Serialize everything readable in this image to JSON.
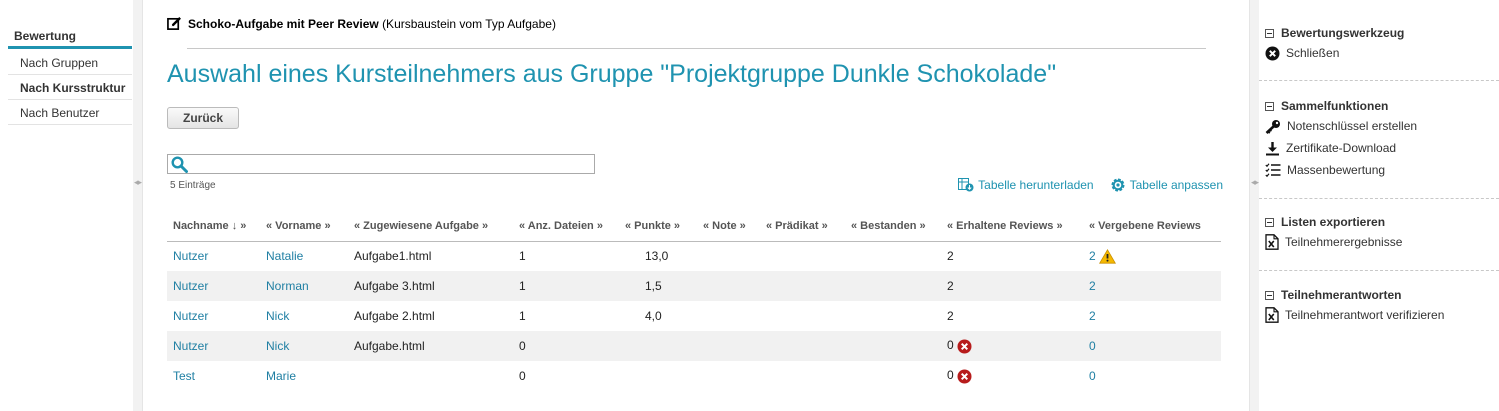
{
  "left_nav": {
    "header": "Bewertung",
    "items": [
      {
        "label": "Nach Gruppen",
        "active": false
      },
      {
        "label": "Nach Kursstruktur",
        "active": true
      },
      {
        "label": "Nach Benutzer",
        "active": false
      }
    ]
  },
  "main": {
    "course_node_title": "Schoko-Aufgabe mit Peer Review",
    "course_node_type": "(Kursbaustein vom Typ Aufgabe)",
    "page_title": "Auswahl eines Kursteilnehmers aus Gruppe \"Projektgruppe Dunkle Schokolade\"",
    "back_button": "Zurück",
    "search": {
      "value": "",
      "placeholder": ""
    },
    "entries_count": "5 Einträge",
    "download_table": "Tabelle herunterladen",
    "customize_table": "Tabelle anpassen",
    "columns": [
      "Nachname ↓ »",
      "« Vorname »",
      "« Zugewiesene Aufgabe »",
      "« Anz. Dateien »",
      "« Punkte »",
      "« Note »",
      "« Prädikat »",
      "« Bestanden »",
      "« Erhaltene Reviews »",
      "« Vergebene Reviews"
    ],
    "rows": [
      {
        "lastname": "Nutzer",
        "firstname": "Natalie",
        "task": "Aufgabe1.html",
        "files": "1",
        "points": "13,0",
        "grade": "",
        "predicate": "",
        "passed": "",
        "received": "2",
        "received_error": false,
        "given": "2",
        "given_warning": true
      },
      {
        "lastname": "Nutzer",
        "firstname": "Norman",
        "task": "Aufgabe 3.html",
        "files": "1",
        "points": "1,5",
        "grade": "",
        "predicate": "",
        "passed": "",
        "received": "2",
        "received_error": false,
        "given": "2",
        "given_warning": false
      },
      {
        "lastname": "Nutzer",
        "firstname": "Nick",
        "task": "Aufgabe 2.html",
        "files": "1",
        "points": "4,0",
        "grade": "",
        "predicate": "",
        "passed": "",
        "received": "2",
        "received_error": false,
        "given": "2",
        "given_warning": false
      },
      {
        "lastname": "Nutzer",
        "firstname": "Nick",
        "task": "Aufgabe.html",
        "files": "0",
        "points": "",
        "grade": "",
        "predicate": "",
        "passed": "",
        "received": "0",
        "received_error": true,
        "given": "0",
        "given_warning": false
      },
      {
        "lastname": "Test",
        "firstname": "Marie",
        "task": "",
        "files": "0",
        "points": "",
        "grade": "",
        "predicate": "",
        "passed": "",
        "received": "0",
        "received_error": true,
        "given": "0",
        "given_warning": false
      }
    ]
  },
  "right_panel": {
    "tool": {
      "header": "Bewertungswerkzeug",
      "close": "Schließen"
    },
    "bulk": {
      "header": "Sammelfunktionen",
      "grading_scale": "Notenschlüssel erstellen",
      "certificates": "Zertifikate-Download",
      "mass_grading": "Massenbewertung"
    },
    "export": {
      "header": "Listen exportieren",
      "results": "Teilnehmerergebnisse"
    },
    "answers": {
      "header": "Teilnehmerantworten",
      "verify": "Teilnehmerantwort verifizieren"
    }
  },
  "colors": {
    "accent": "#1f93b0",
    "link": "#1f7fa3",
    "error": "#b71c1c",
    "warning": "#f5b800"
  }
}
